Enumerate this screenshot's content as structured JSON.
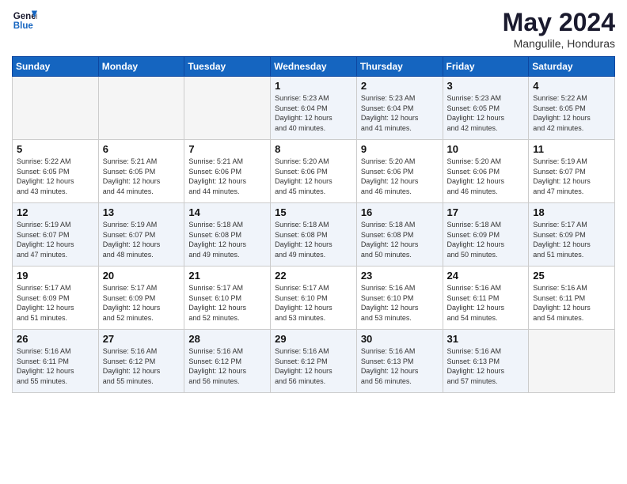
{
  "header": {
    "logo_line1": "General",
    "logo_line2": "Blue",
    "month": "May 2024",
    "location": "Mangulile, Honduras"
  },
  "weekdays": [
    "Sunday",
    "Monday",
    "Tuesday",
    "Wednesday",
    "Thursday",
    "Friday",
    "Saturday"
  ],
  "weeks": [
    [
      {
        "day": "",
        "info": ""
      },
      {
        "day": "",
        "info": ""
      },
      {
        "day": "",
        "info": ""
      },
      {
        "day": "1",
        "info": "Sunrise: 5:23 AM\nSunset: 6:04 PM\nDaylight: 12 hours\nand 40 minutes."
      },
      {
        "day": "2",
        "info": "Sunrise: 5:23 AM\nSunset: 6:04 PM\nDaylight: 12 hours\nand 41 minutes."
      },
      {
        "day": "3",
        "info": "Sunrise: 5:23 AM\nSunset: 6:05 PM\nDaylight: 12 hours\nand 42 minutes."
      },
      {
        "day": "4",
        "info": "Sunrise: 5:22 AM\nSunset: 6:05 PM\nDaylight: 12 hours\nand 42 minutes."
      }
    ],
    [
      {
        "day": "5",
        "info": "Sunrise: 5:22 AM\nSunset: 6:05 PM\nDaylight: 12 hours\nand 43 minutes."
      },
      {
        "day": "6",
        "info": "Sunrise: 5:21 AM\nSunset: 6:05 PM\nDaylight: 12 hours\nand 44 minutes."
      },
      {
        "day": "7",
        "info": "Sunrise: 5:21 AM\nSunset: 6:06 PM\nDaylight: 12 hours\nand 44 minutes."
      },
      {
        "day": "8",
        "info": "Sunrise: 5:20 AM\nSunset: 6:06 PM\nDaylight: 12 hours\nand 45 minutes."
      },
      {
        "day": "9",
        "info": "Sunrise: 5:20 AM\nSunset: 6:06 PM\nDaylight: 12 hours\nand 46 minutes."
      },
      {
        "day": "10",
        "info": "Sunrise: 5:20 AM\nSunset: 6:06 PM\nDaylight: 12 hours\nand 46 minutes."
      },
      {
        "day": "11",
        "info": "Sunrise: 5:19 AM\nSunset: 6:07 PM\nDaylight: 12 hours\nand 47 minutes."
      }
    ],
    [
      {
        "day": "12",
        "info": "Sunrise: 5:19 AM\nSunset: 6:07 PM\nDaylight: 12 hours\nand 47 minutes."
      },
      {
        "day": "13",
        "info": "Sunrise: 5:19 AM\nSunset: 6:07 PM\nDaylight: 12 hours\nand 48 minutes."
      },
      {
        "day": "14",
        "info": "Sunrise: 5:18 AM\nSunset: 6:08 PM\nDaylight: 12 hours\nand 49 minutes."
      },
      {
        "day": "15",
        "info": "Sunrise: 5:18 AM\nSunset: 6:08 PM\nDaylight: 12 hours\nand 49 minutes."
      },
      {
        "day": "16",
        "info": "Sunrise: 5:18 AM\nSunset: 6:08 PM\nDaylight: 12 hours\nand 50 minutes."
      },
      {
        "day": "17",
        "info": "Sunrise: 5:18 AM\nSunset: 6:09 PM\nDaylight: 12 hours\nand 50 minutes."
      },
      {
        "day": "18",
        "info": "Sunrise: 5:17 AM\nSunset: 6:09 PM\nDaylight: 12 hours\nand 51 minutes."
      }
    ],
    [
      {
        "day": "19",
        "info": "Sunrise: 5:17 AM\nSunset: 6:09 PM\nDaylight: 12 hours\nand 51 minutes."
      },
      {
        "day": "20",
        "info": "Sunrise: 5:17 AM\nSunset: 6:09 PM\nDaylight: 12 hours\nand 52 minutes."
      },
      {
        "day": "21",
        "info": "Sunrise: 5:17 AM\nSunset: 6:10 PM\nDaylight: 12 hours\nand 52 minutes."
      },
      {
        "day": "22",
        "info": "Sunrise: 5:17 AM\nSunset: 6:10 PM\nDaylight: 12 hours\nand 53 minutes."
      },
      {
        "day": "23",
        "info": "Sunrise: 5:16 AM\nSunset: 6:10 PM\nDaylight: 12 hours\nand 53 minutes."
      },
      {
        "day": "24",
        "info": "Sunrise: 5:16 AM\nSunset: 6:11 PM\nDaylight: 12 hours\nand 54 minutes."
      },
      {
        "day": "25",
        "info": "Sunrise: 5:16 AM\nSunset: 6:11 PM\nDaylight: 12 hours\nand 54 minutes."
      }
    ],
    [
      {
        "day": "26",
        "info": "Sunrise: 5:16 AM\nSunset: 6:11 PM\nDaylight: 12 hours\nand 55 minutes."
      },
      {
        "day": "27",
        "info": "Sunrise: 5:16 AM\nSunset: 6:12 PM\nDaylight: 12 hours\nand 55 minutes."
      },
      {
        "day": "28",
        "info": "Sunrise: 5:16 AM\nSunset: 6:12 PM\nDaylight: 12 hours\nand 56 minutes."
      },
      {
        "day": "29",
        "info": "Sunrise: 5:16 AM\nSunset: 6:12 PM\nDaylight: 12 hours\nand 56 minutes."
      },
      {
        "day": "30",
        "info": "Sunrise: 5:16 AM\nSunset: 6:13 PM\nDaylight: 12 hours\nand 56 minutes."
      },
      {
        "day": "31",
        "info": "Sunrise: 5:16 AM\nSunset: 6:13 PM\nDaylight: 12 hours\nand 57 minutes."
      },
      {
        "day": "",
        "info": ""
      }
    ]
  ]
}
